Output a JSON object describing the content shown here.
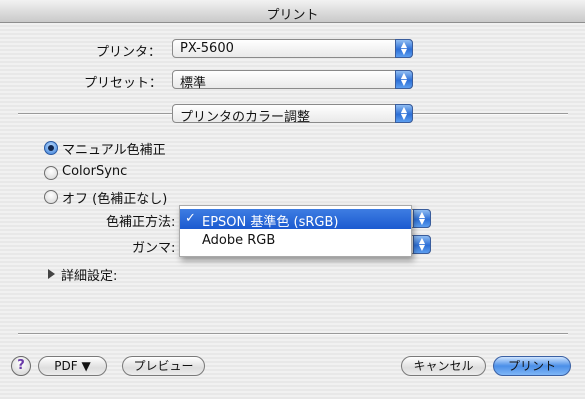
{
  "window": {
    "title": "プリント"
  },
  "printer": {
    "label": "プリンタ：",
    "value": "PX-5600"
  },
  "preset": {
    "label": "プリセット：",
    "value": "標準"
  },
  "panel": {
    "value": "プリンタのカラー調整"
  },
  "color_mode": {
    "options": [
      {
        "label": "マニュアル色補正",
        "selected": true
      },
      {
        "label": "ColorSync",
        "selected": false
      },
      {
        "label": "オフ (色補正なし)",
        "selected": false
      }
    ]
  },
  "correction_method": {
    "label": "色補正方法:",
    "menu_items": [
      {
        "label": "EPSON 基準色 (sRGB)",
        "checked": true,
        "highlighted": true
      },
      {
        "label": "Adobe RGB",
        "checked": false,
        "highlighted": false
      }
    ]
  },
  "gamma": {
    "label": "ガンマ:"
  },
  "details": {
    "label": "詳細設定:"
  },
  "buttons": {
    "help": "?",
    "pdf": "PDF ▼",
    "preview": "プレビュー",
    "cancel": "キャンセル",
    "print": "プリント"
  },
  "icons": {
    "popup_arrows": "▲▼",
    "check": "✓",
    "disclosure": "right-triangle-icon"
  }
}
